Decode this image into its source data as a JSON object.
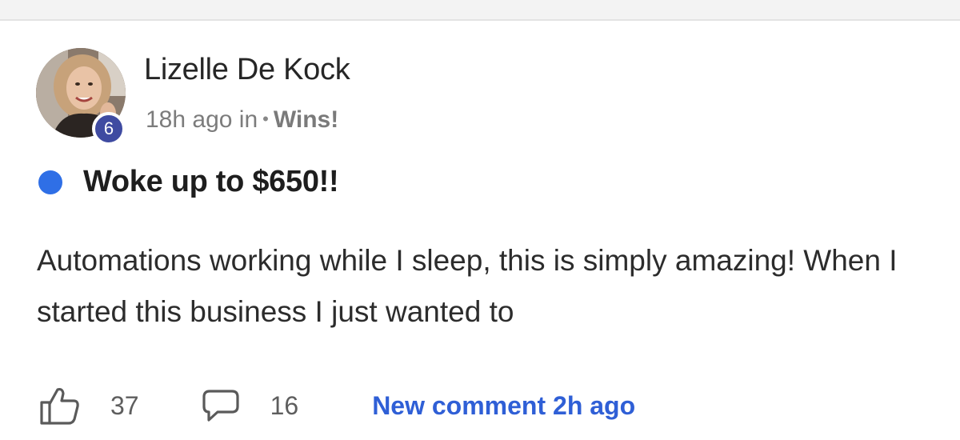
{
  "post": {
    "author": {
      "name": "Lizelle De Kock",
      "level": "6",
      "avatar_icon": "profile-photo"
    },
    "meta": {
      "time": "18h ago in",
      "separator": "•",
      "category": "Wins!"
    },
    "unread": true,
    "title": "Woke up to $650!!",
    "body": "Automations working while I sleep, this is simply amazing! When I started this business I just wanted to",
    "actions": {
      "likes": "37",
      "comments": "16",
      "new_comment": "New comment 2h ago"
    }
  },
  "colors": {
    "accent": "#2f6fe6",
    "link": "#2f5fd6",
    "badge": "#3f4ba1"
  }
}
